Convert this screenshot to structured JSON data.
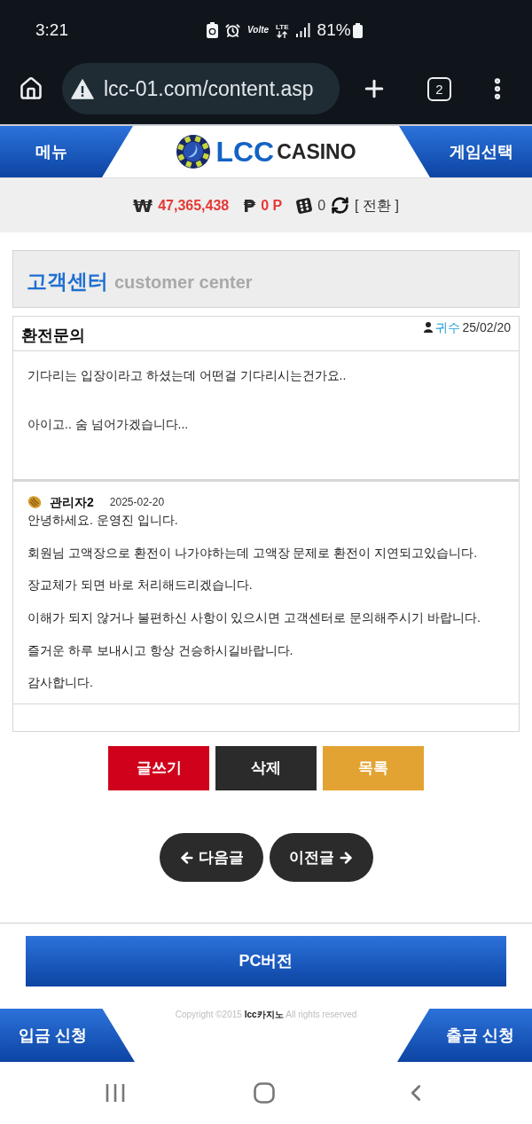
{
  "status_bar": {
    "time": "3:21",
    "volte": "Volte",
    "network": "LTE",
    "battery": "81%"
  },
  "browser": {
    "url": "lcc-01.com/content.asp",
    "tab_count": "2"
  },
  "header": {
    "menu": "메뉴",
    "logo_primary": "LCC",
    "logo_secondary": "CASINO",
    "game_select": "게임선택"
  },
  "balance": {
    "money_symbol": "₩",
    "money": "47,365,438",
    "points_symbol": "₱",
    "points": "0 P",
    "chips": "0",
    "exchange": "[ 전환 ]"
  },
  "section": {
    "title": "고객센터",
    "subtitle": "customer center"
  },
  "post": {
    "title": "환전문의",
    "author": "귀수",
    "date": "25/02/20",
    "paragraphs": [
      "기다리는 입장이라고 하셨는데 어떤걸 기다리시는건가요..",
      "아이고.. 숨 넘어가겠습니다..."
    ]
  },
  "reply": {
    "author": "관리자2",
    "date": "2025-02-20",
    "paragraphs": [
      "안녕하세요. 운영진 입니다.",
      "회원님 고액장으로 환전이 나가야하는데 고액장 문제로 환전이 지연되고있습니다.",
      "장교체가 되면 바로 처리해드리겠습니다.",
      "이해가 되지 않거나 불편하신 사항이 있으시면 고객센터로 문의해주시기 바랍니다.",
      "즐거운 하루 보내시고 항상 건승하시길바랍니다.",
      "감사합니다."
    ]
  },
  "actions": [
    {
      "label": "글쓰기",
      "color": "#d0021b"
    },
    {
      "label": "삭제",
      "color": "#2b2b2b"
    },
    {
      "label": "목록",
      "color": "#e3a332"
    }
  ],
  "pager": [
    {
      "label": "다음글",
      "kind": "prev"
    },
    {
      "label": "이전글",
      "kind": "next"
    }
  ],
  "pc_version": "PC버전",
  "copyright": "Copyright ©2015 **lcc카지노** All rights reserved",
  "quick_buttons": [
    {
      "label": "입금 신청",
      "kind": "left"
    },
    {
      "label": "출금 신청",
      "kind": "right"
    }
  ]
}
